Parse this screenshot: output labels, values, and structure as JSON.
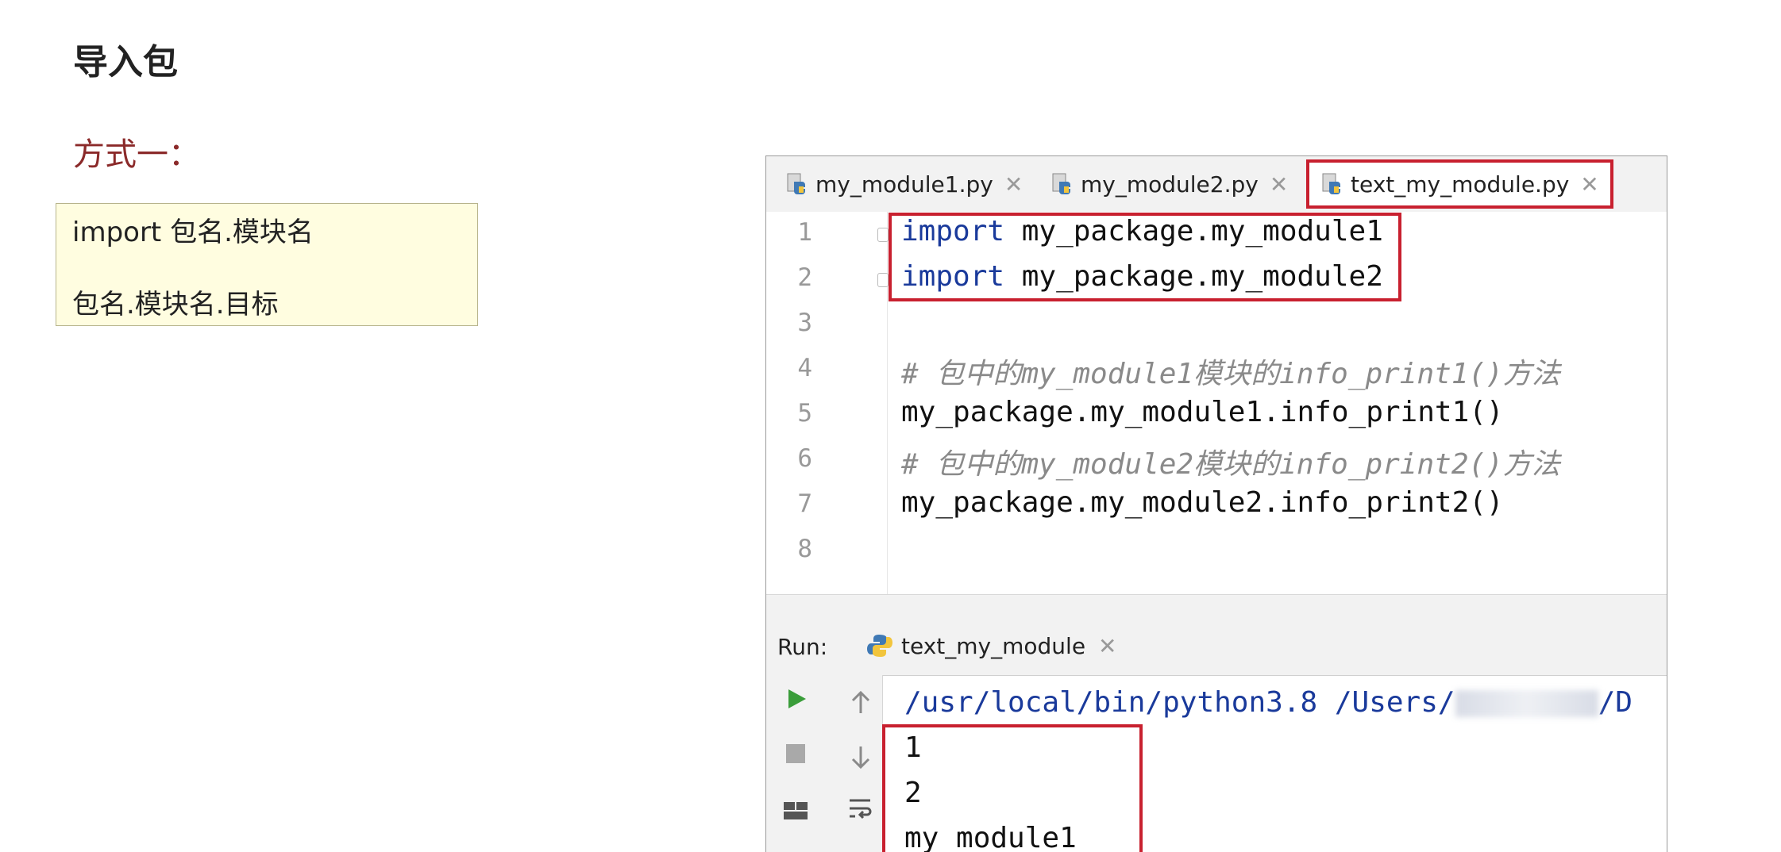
{
  "slide": {
    "title": "导入包",
    "subtitle": "方式一：",
    "note": {
      "line1": "import 包名.模块名",
      "line2": "包名.模块名.目标"
    }
  },
  "ide": {
    "tabs": [
      {
        "label": "my_module1.py",
        "active": false
      },
      {
        "label": "my_module2.py",
        "active": false
      },
      {
        "label": "text_my_module.py",
        "active": true
      }
    ],
    "line_numbers": [
      "1",
      "2",
      "3",
      "4",
      "5",
      "6",
      "7",
      "8"
    ],
    "code": {
      "l1_kw": "import",
      "l1_rest": " my_package.my_module1",
      "l2_kw": "import",
      "l2_rest": " my_package.my_module2",
      "l4": "# 包中的my_module1模块的info_print1()方法",
      "l5": "my_package.my_module1.info_print1()",
      "l6": "# 包中的my_module2模块的info_print2()方法",
      "l7": "my_package.my_module2.info_print2()"
    },
    "run": {
      "label": "Run:",
      "tab": "text_my_module",
      "output_path_prefix": "/usr/local/bin/python3.8 /Users/",
      "output_path_suffix": "/D",
      "output_lines": [
        "1",
        "2",
        "my_module1"
      ]
    },
    "colors": {
      "highlight": "#c8202f",
      "keyword": "#1a3a9b",
      "run_green": "#3a9d3a"
    },
    "icons": [
      "python-file-icon",
      "close-icon",
      "run-icon",
      "stop-icon",
      "arrow-up-icon",
      "arrow-down-icon",
      "soft-wrap-icon",
      "layout-icon"
    ]
  }
}
